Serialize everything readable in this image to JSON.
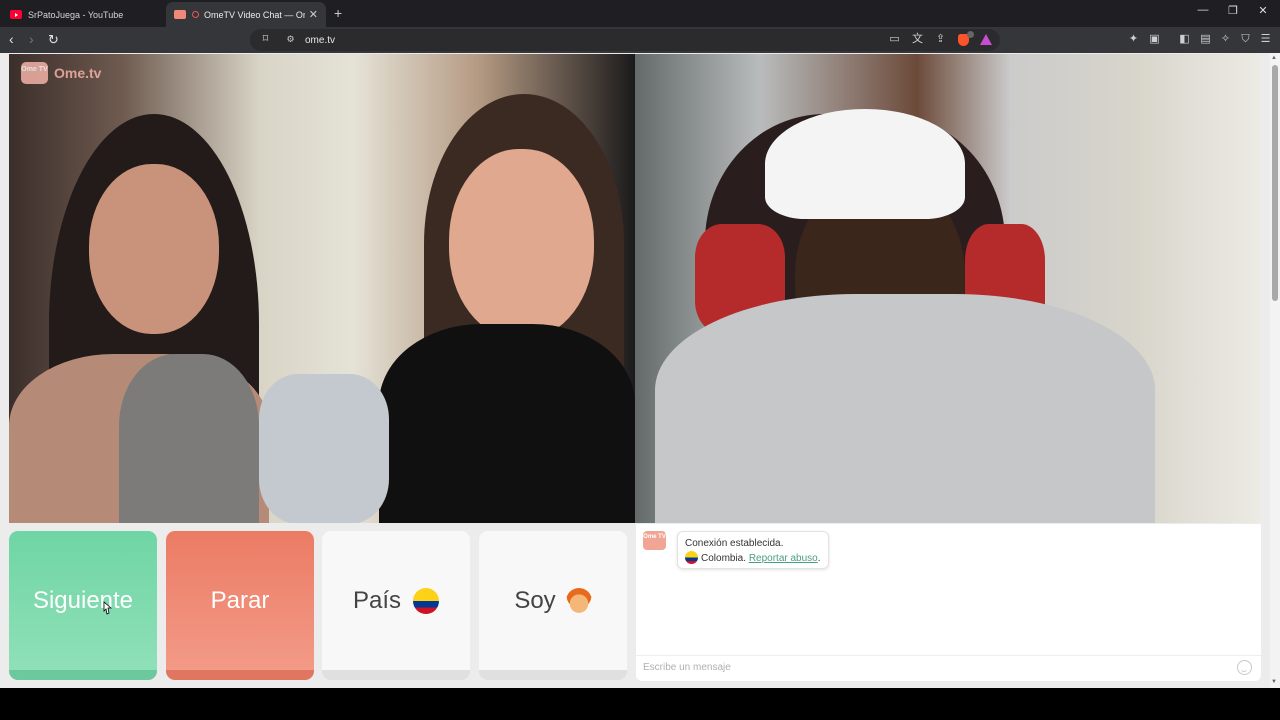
{
  "browser": {
    "tabs": [
      {
        "title": "SrPatoJuega - YouTube",
        "active": false,
        "icon": "youtube-icon"
      },
      {
        "title": "OmeTV Video Chat — Omegl",
        "active": true,
        "icon": "ometv-icon"
      }
    ],
    "url": "ome.tv"
  },
  "app": {
    "logo_text": "Ome.tv",
    "logo_badge": "Ome TV"
  },
  "controls": {
    "next_label": "Siguiente",
    "stop_label": "Parar",
    "country_label": "País",
    "gender_label": "Soy"
  },
  "chat": {
    "status_line": "Conexión establecida.",
    "country": "Colombia.",
    "report_link": "Reportar abuso",
    "report_suffix": ".",
    "input_placeholder": "Escribe un mensaje"
  },
  "colors": {
    "next": "#6fd5a4",
    "stop": "#ec7b64",
    "link": "#4d9c84"
  }
}
